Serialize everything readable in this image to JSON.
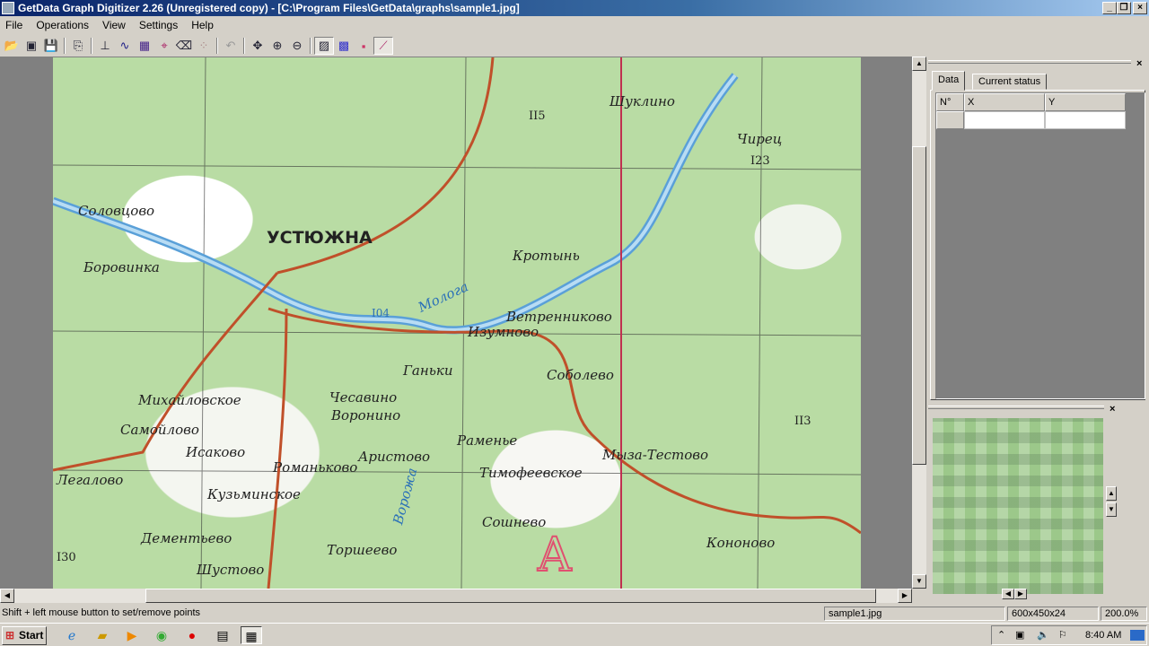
{
  "window": {
    "title": "GetData Graph Digitizer 2.26 (Unregistered copy) - [C:\\Program Files\\GetData\\graphs\\sample1.jpg]"
  },
  "menu": [
    "File",
    "Operations",
    "View",
    "Settings",
    "Help"
  ],
  "toolbar": [
    "open-icon",
    "scan-icon",
    "save-icon",
    "copy-icon",
    "axes-icon",
    "auto-trace-icon",
    "area-icon",
    "point-capture-icon",
    "eraser-icon",
    "order-points-icon",
    "undo-icon",
    "pan-icon",
    "zoom-in-icon",
    "zoom-out-icon",
    "image-icon",
    "grid-icon",
    "colors-icon",
    "graph-icon"
  ],
  "map": {
    "labels": [
      "Соловцово",
      "УСТЮЖНА",
      "Боровинка",
      "Шуклино",
      "Чирец",
      "I23",
      "II5",
      "Кротынь",
      "Молога",
      "I04",
      "Ветренниково",
      "Изумново",
      "Соболево",
      "Ганьки",
      "Михайловское",
      "Чесавино",
      "Воронино",
      "Самойлово",
      "Исаково",
      "Раменье",
      "Аристово",
      "Мыза-Тестово",
      "Романьково",
      "Тимофеевское",
      "Легалово",
      "Кузьминское",
      "Дементьево",
      "Сошнево",
      "Кононово",
      "I30",
      "Шустово",
      "Торшеево",
      "Ворожа",
      "II3",
      "A"
    ]
  },
  "data_panel": {
    "tabs": [
      "Data",
      "Current status"
    ],
    "columns": [
      "N°",
      "X",
      "Y"
    ]
  },
  "status": {
    "hint": "Shift + left mouse button to set/remove points",
    "file": "sample1.jpg",
    "image_size": "600x450x24",
    "zoom": "200.0%"
  },
  "taskbar": {
    "start": "Start",
    "clock": "8:40 AM"
  },
  "colors": {
    "title": "#0a246a",
    "map_green": "#b9dca4",
    "road": "#c0502a",
    "river": "#5aa0d8"
  }
}
